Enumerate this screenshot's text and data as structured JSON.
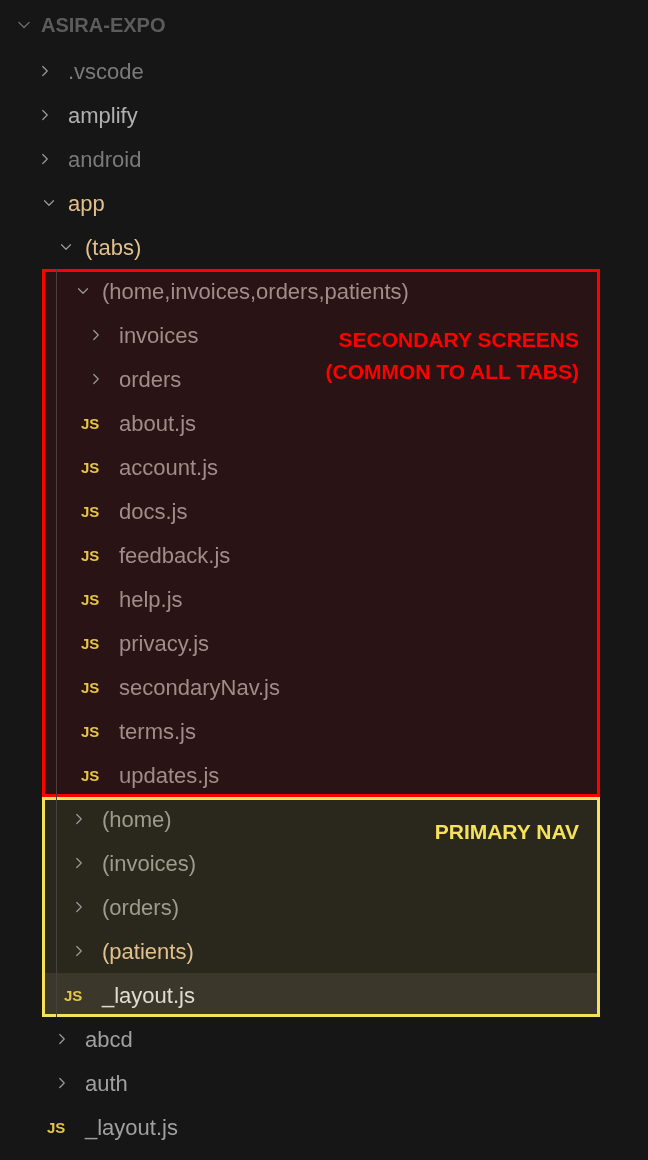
{
  "explorer": {
    "title": "ASIRA-EXPO",
    "expanded": true
  },
  "tree": [
    {
      "name": ".vscode",
      "kind": "folder",
      "expanded": false,
      "color": "#7a7a7a",
      "selected": false
    },
    {
      "name": "amplify",
      "kind": "folder",
      "expanded": false,
      "color": "#b0b0b0",
      "selected": false
    },
    {
      "name": "android",
      "kind": "folder",
      "expanded": false,
      "color": "#7a7a7a",
      "selected": false
    },
    {
      "name": "app",
      "kind": "folder",
      "expanded": true,
      "color": "#e2c08d",
      "selected": false,
      "children": [
        {
          "name": "(tabs)",
          "kind": "folder",
          "expanded": true,
          "color": "#e2c08d",
          "selected": false,
          "groups": [
            {
              "note": [
                "SECONDARY SCREENS",
                "(COMMON TO ALL TABS)"
              ],
              "color": "#ff0000",
              "children": [
                {
                  "name": "(home,invoices,orders,patients)",
                  "kind": "folder",
                  "expanded": true,
                  "color": "#a08c8a",
                  "selected": false,
                  "children": [
                    {
                      "name": "invoices",
                      "kind": "folder",
                      "expanded": false,
                      "color": "#a08c8a",
                      "selected": false
                    },
                    {
                      "name": "orders",
                      "kind": "folder",
                      "expanded": false,
                      "color": "#a08c8a",
                      "selected": false
                    },
                    {
                      "name": "about.js",
                      "kind": "file",
                      "badge": "JS",
                      "color": "#a08c8a",
                      "selected": false
                    },
                    {
                      "name": "account.js",
                      "kind": "file",
                      "badge": "JS",
                      "color": "#a08c8a",
                      "selected": false
                    },
                    {
                      "name": "docs.js",
                      "kind": "file",
                      "badge": "JS",
                      "color": "#a08c8a",
                      "selected": false
                    },
                    {
                      "name": "feedback.js",
                      "kind": "file",
                      "badge": "JS",
                      "color": "#a08c8a",
                      "selected": false
                    },
                    {
                      "name": "help.js",
                      "kind": "file",
                      "badge": "JS",
                      "color": "#a08c8a",
                      "selected": false
                    },
                    {
                      "name": "privacy.js",
                      "kind": "file",
                      "badge": "JS",
                      "color": "#a08c8a",
                      "selected": false
                    },
                    {
                      "name": "secondaryNav.js",
                      "kind": "file",
                      "badge": "JS",
                      "color": "#a08c8a",
                      "selected": false
                    },
                    {
                      "name": "terms.js",
                      "kind": "file",
                      "badge": "JS",
                      "color": "#a08c8a",
                      "selected": false
                    },
                    {
                      "name": "updates.js",
                      "kind": "file",
                      "badge": "JS",
                      "color": "#a08c8a",
                      "selected": false
                    }
                  ]
                }
              ]
            },
            {
              "note": [
                "PRIMARY NAV"
              ],
              "color": "#f5e15a",
              "children": [
                {
                  "name": "(home)",
                  "kind": "folder",
                  "expanded": false,
                  "color": "#9e9b8e",
                  "selected": false
                },
                {
                  "name": "(invoices)",
                  "kind": "folder",
                  "expanded": false,
                  "color": "#9e9b8e",
                  "selected": false
                },
                {
                  "name": "(orders)",
                  "kind": "folder",
                  "expanded": false,
                  "color": "#9e9b8e",
                  "selected": false
                },
                {
                  "name": "(patients)",
                  "kind": "folder",
                  "expanded": false,
                  "color": "#e2c08d",
                  "selected": false
                },
                {
                  "name": "_layout.js",
                  "kind": "file",
                  "badge": "JS",
                  "color": "#e0ddd0",
                  "selected": true
                }
              ]
            }
          ]
        },
        {
          "name": "abcd",
          "kind": "folder",
          "expanded": false,
          "color": "#a0a0a0",
          "selected": false
        },
        {
          "name": "auth",
          "kind": "folder",
          "expanded": false,
          "color": "#a0a0a0",
          "selected": false
        },
        {
          "name": "_layout.js",
          "kind": "file",
          "badge": "JS",
          "color": "#a0a0a0",
          "selected": false
        }
      ]
    }
  ]
}
